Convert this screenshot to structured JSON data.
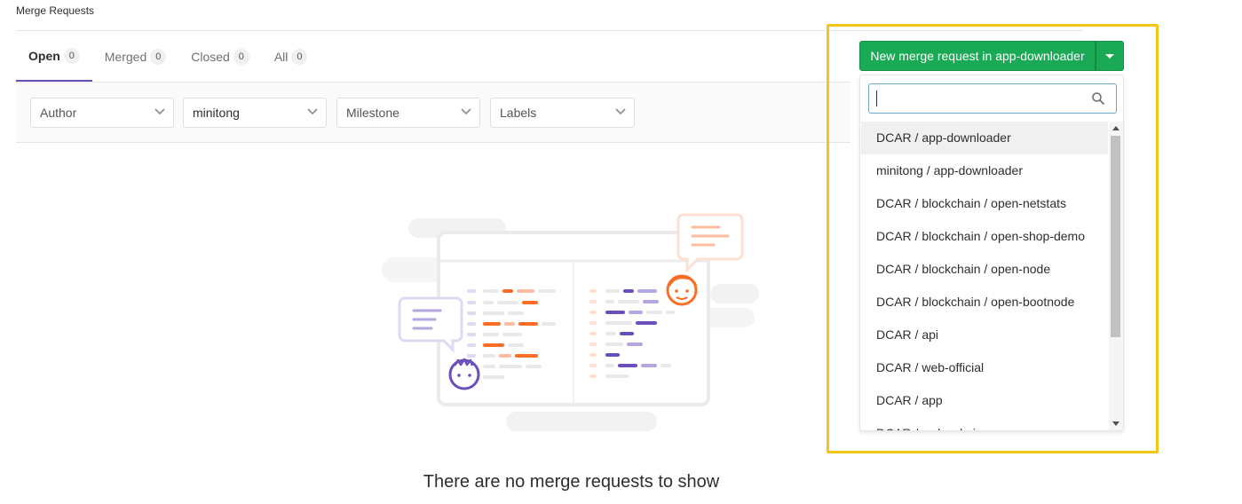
{
  "page": {
    "title": "Merge Requests"
  },
  "tabs": [
    {
      "label": "Open",
      "count": "0",
      "active": true
    },
    {
      "label": "Merged",
      "count": "0"
    },
    {
      "label": "Closed",
      "count": "0"
    },
    {
      "label": "All",
      "count": "0"
    }
  ],
  "filters": {
    "author": "Author",
    "assignee": "minitong",
    "milestone": "Milestone",
    "labels": "Labels"
  },
  "new_mr": {
    "label": "New merge request in app-downloader"
  },
  "dropdown": {
    "search_value": "",
    "items": [
      "DCAR / app-downloader",
      "minitong / app-downloader",
      "DCAR / blockchain / open-netstats",
      "DCAR / blockchain / open-shop-demo",
      "DCAR / blockchain / open-node",
      "DCAR / blockchain / open-bootnode",
      "DCAR / api",
      "DCAR / web-official",
      "DCAR / app",
      "DCAR / web-admin"
    ]
  },
  "empty_state": {
    "message": "There are no merge requests to show"
  },
  "colors": {
    "accent_purple": "#6b4fbb",
    "button_green": "#1aaa55",
    "highlight_yellow": "#f5c518",
    "illustration_orange": "#fc6d26"
  }
}
